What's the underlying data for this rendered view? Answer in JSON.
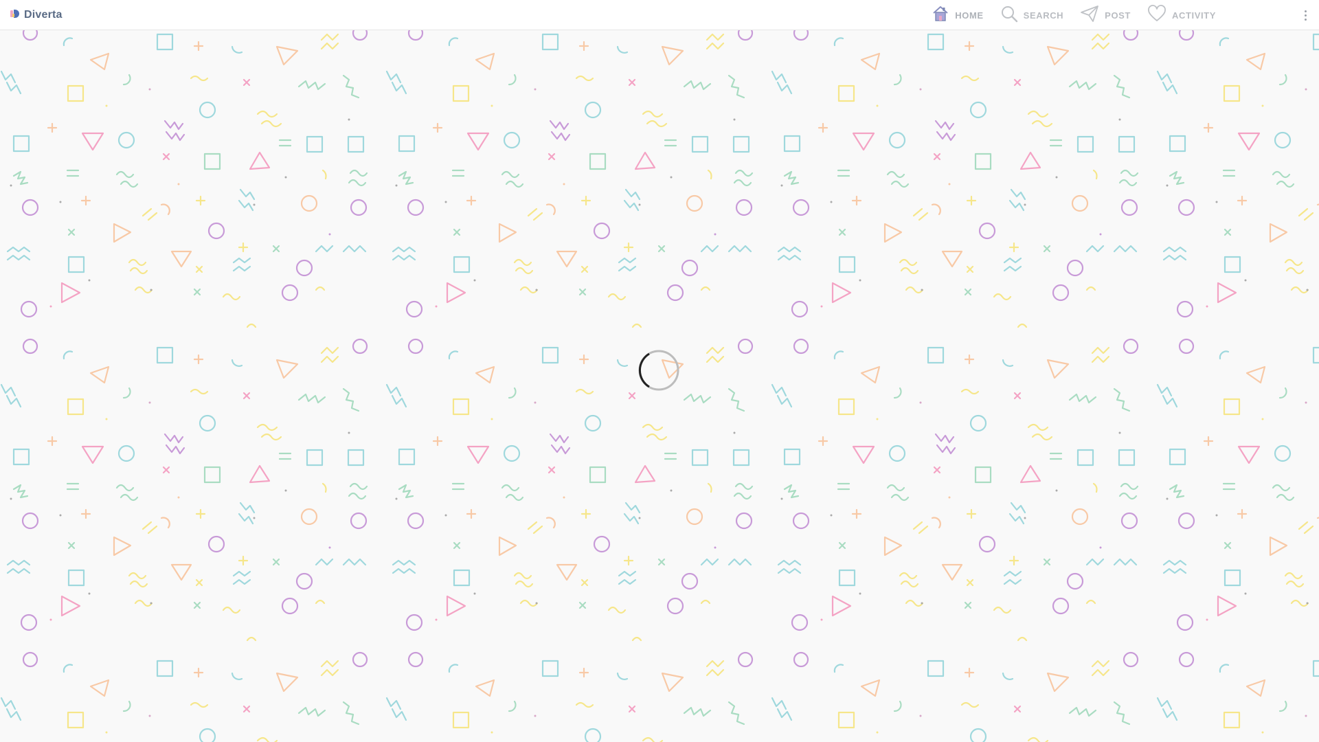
{
  "app": {
    "brand_name": "Diverta"
  },
  "nav": {
    "items": [
      {
        "label": "HOME",
        "icon": "home-icon",
        "active": true
      },
      {
        "label": "SEARCH",
        "icon": "search-icon",
        "active": false
      },
      {
        "label": "POST",
        "icon": "paper-plane-icon",
        "active": false
      },
      {
        "label": "ACTIVITY",
        "icon": "heart-icon",
        "active": false
      }
    ]
  },
  "menu": {
    "icon": "more-vertical-icon"
  },
  "loading": {
    "icon": "spinner-icon"
  },
  "colors": {
    "accent": "#7b86b3",
    "nav_text": "#b9bcc1",
    "background": "#f9f9f9",
    "pattern_pink": "#f4a3c4",
    "pattern_teal": "#9fd8dd",
    "pattern_purple": "#c89ad8",
    "pattern_yellow": "#f6e68a",
    "pattern_orange": "#f8c9a6",
    "pattern_green": "#a9dcc2"
  }
}
